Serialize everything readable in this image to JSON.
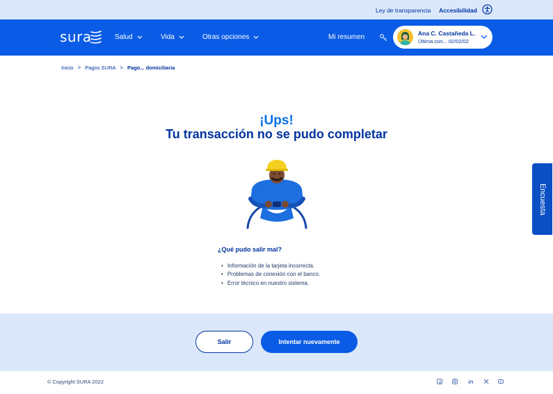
{
  "topbar": {
    "transparency_link": "Ley de transparencia",
    "accessibility_link": "Accesibilidad"
  },
  "nav": {
    "logo": "sura",
    "items": [
      {
        "label": "Salud"
      },
      {
        "label": "Vida"
      },
      {
        "label": "Otras opciones"
      }
    ],
    "summary": "Mi resumen",
    "user": {
      "name": "Ana C. Castañeda L.",
      "last_connection": "Última con... 02/02/02"
    }
  },
  "breadcrumb": {
    "items": [
      "Inicio",
      "Pagos SURA",
      "Pago... domiciliaria"
    ],
    "separator": ">"
  },
  "message": {
    "title_line1": "¡Ups!",
    "title_line2": "Tu transacción no se pudo completar",
    "question": "¿Qué pudo salir mal?",
    "reasons": [
      "Información de la tarjeta incorrecta.",
      "Problemas de conexión con el banco.",
      "Error técnico en nuestro sistema."
    ]
  },
  "survey_tab": "Encuesta",
  "actions": {
    "exit_label": "Salir",
    "retry_label": "Intentar nuevamente"
  },
  "footer": {
    "copyright": "© Copyright SURA 2022",
    "social_icons": [
      "facebook-icon",
      "instagram-icon",
      "linkedin-icon",
      "x-icon",
      "youtube-icon"
    ]
  },
  "colors": {
    "brand_blue": "#0a5ce6",
    "dark_blue": "#0033a0",
    "accent_blue": "#0a6fe8",
    "light_band": "#dbe8fb"
  }
}
